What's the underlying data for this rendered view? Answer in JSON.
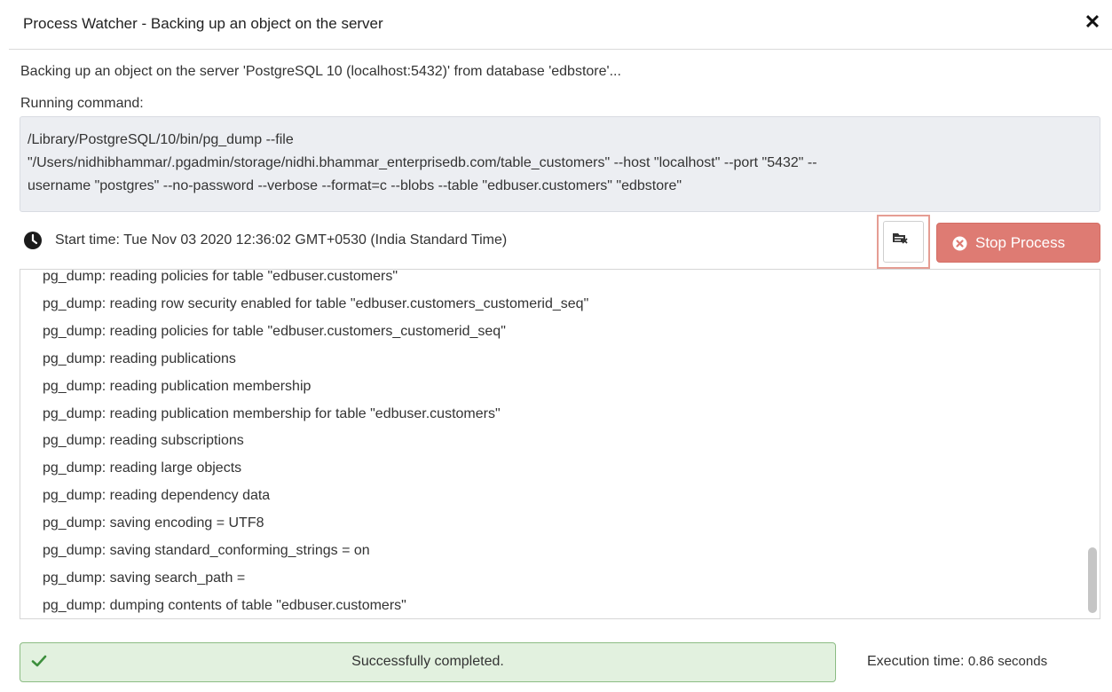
{
  "dialog": {
    "title": "Process Watcher - Backing up an object on the server",
    "close_glyph": "✕",
    "description": "Backing up an object on the server 'PostgreSQL 10 (localhost:5432)' from database 'edbstore'...",
    "running_label": "Running command:",
    "command_lines": [
      "/Library/PostgreSQL/10/bin/pg_dump --file",
      "\"/Users/nidhibhammar/.pgadmin/storage/nidhi.bhammar_enterprisedb.com/table_customers\" --host \"localhost\" --port \"5432\" --",
      "username \"postgres\" --no-password --verbose --format=c --blobs --table \"edbuser.customers\" \"edbstore\""
    ],
    "start_time": "Start time: Tue Nov 03 2020 12:36:02 GMT+0530 (India Standard Time)",
    "stop_button_label": "Stop Process",
    "log_lines": [
      "pg_dump: reading policies for table \"edbuser.customers\"",
      "pg_dump: reading row security enabled for table \"edbuser.customers_customerid_seq\"",
      "pg_dump: reading policies for table \"edbuser.customers_customerid_seq\"",
      "pg_dump: reading publications",
      "pg_dump: reading publication membership",
      "pg_dump: reading publication membership for table \"edbuser.customers\"",
      "pg_dump: reading subscriptions",
      "pg_dump: reading large objects",
      "pg_dump: reading dependency data",
      "pg_dump: saving encoding = UTF8",
      "pg_dump: saving standard_conforming_strings = on",
      "pg_dump: saving search_path =",
      "pg_dump: dumping contents of table \"edbuser.customers\""
    ],
    "status_text": "Successfully completed.",
    "execution_label": "Execution time:",
    "execution_value": "0.86 seconds"
  },
  "icons": {
    "close": "close-icon",
    "clock": "clock-icon",
    "log_toggle": "folder-log-icon",
    "stop": "times-circle-icon",
    "status": "check-icon"
  },
  "colors": {
    "stop_button": "#de7b73",
    "success_bg": "#e2f1df",
    "success_border": "#8cbc84",
    "success_check": "#3d8f3d",
    "highlight_border": "#e59d93",
    "command_bg": "#eceef2"
  }
}
